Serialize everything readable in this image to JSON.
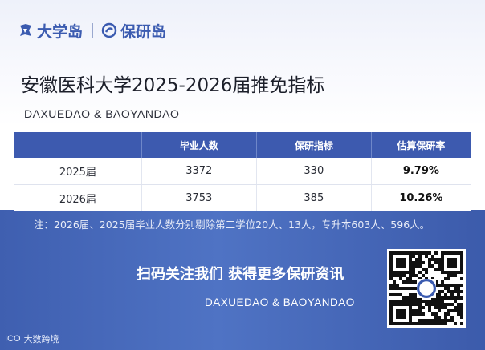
{
  "logo": {
    "left_text": "大学岛",
    "right_text": "保研岛"
  },
  "title": "安徽医科大学2025-2026届推免指标",
  "subtitle": "DAXUEDAO & BAOYANDAO",
  "table": {
    "headers": [
      "",
      "毕业人数",
      "保研指标",
      "估算保研率"
    ],
    "rows": [
      {
        "year": "2025届",
        "graduates": "3372",
        "quota": "330",
        "rate": "9.79%"
      },
      {
        "year": "2026届",
        "graduates": "3753",
        "quota": "385",
        "rate": "10.26%"
      }
    ]
  },
  "note": "注：2026届、2025届毕业人数分别剔除第二学位20人、13人，专升本603人、596人。",
  "slogan": "扫码关注我们 获得更多保研资讯",
  "brand_en": "DAXUEDAO & BAOYANDAO",
  "footer": {
    "logo": "ICO",
    "text": "大数跨境"
  },
  "colors": {
    "primary": "#3d5aaf",
    "band": "#4f73c4"
  }
}
